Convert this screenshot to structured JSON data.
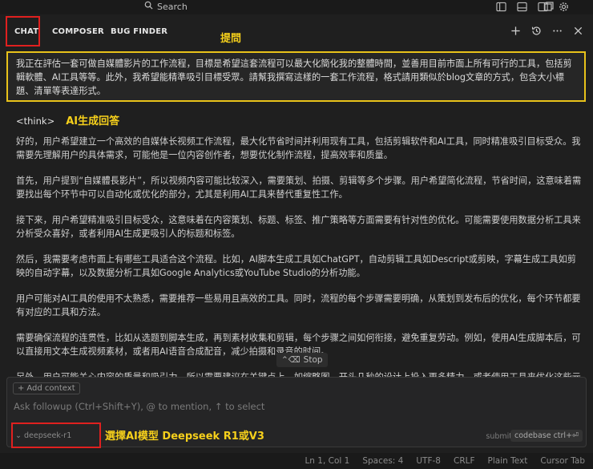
{
  "topbar": {
    "search_label": "Search"
  },
  "tabs": [
    {
      "label": "CHAT"
    },
    {
      "label": "COMPOSER"
    },
    {
      "label": "BUG FINDER"
    }
  ],
  "annotations": {
    "ask": "提問",
    "ai_answer": "AI生成回答",
    "model": "選擇AI模型 Deepseek R1或V3"
  },
  "question": "我正在評估一套可做自媒體影片的工作流程，目標是希望這套流程可以最大化簡化我的整體時間，並善用目前市面上所有可行的工具，包括剪輯軟體、AI工具等等。此外，我希望能精準吸引目標受眾。請幫我撰寫這樣的一套工作流程，格式請用類似於blog文章的方式，包含大小標題、清單等表達形式。",
  "answer": {
    "think_tag": "<think>",
    "paragraphs": [
      "好的，用户希望建立一个高效的自媒体长视频工作流程，最大化节省时间并利用现有工具，包括剪辑软件和AI工具，同时精准吸引目标受众。我需要先理解用户的具体需求，可能他是一位内容创作者，想要优化制作流程，提高效率和质量。",
      "首先，用户提到“自媒體長影片”，所以视频内容可能比较深入，需要策划、拍摄、剪辑等多个步骤。用户希望简化流程，节省时间，这意味着需要找出每个环节中可以自动化或优化的部分，尤其是利用AI工具来替代重复性工作。",
      "接下来，用户希望精准吸引目标受众，这意味着在内容策划、标题、标签、推广策略等方面需要有针对性的优化。可能需要使用数据分析工具来分析受众喜好，或者利用AI生成更吸引人的标题和标签。",
      "然后，我需要考虑市面上有哪些工具适合这个流程。比如，AI脚本生成工具如ChatGPT，自动剪辑工具如Descript或剪映，字幕生成工具如剪映的自动字幕，以及数据分析工具如Google Analytics或YouTube Studio的分析功能。",
      "用户可能对AI工具的使用不太熟悉，需要推荐一些易用且高效的工具。同时，流程的每个步骤需要明确，从策划到发布后的优化，每个环节都要有对应的工具和方法。",
      "需要确保流程的连贯性，比如从选题到脚本生成，再到素材收集和剪辑，每个步骤之间如何衔接，避免重复劳动。例如，使用AI生成脚本后，可以直接用文本生成视频素材，或者用AI语音合成配音，减少拍摄和录音的时间。",
      "另外，用户可能关心内容的质量和吸引力，所以需要建议在关键点上，如缩略图、开头几秒的设计上投入更多精力，或者使用工具来优化这些元素。"
    ],
    "stop_label": "Stop"
  },
  "composer": {
    "add_context_label": "Add context",
    "placeholder": "Ask followup (Ctrl+Shift+Y), @ to mention, ↑ to select",
    "model": "deepseek-r1",
    "submit_label": "submit",
    "codebase_label": "codebase ctrl+⏎"
  },
  "statusbar": {
    "position": "Ln 1, Col 1",
    "spaces": "Spaces: 4",
    "encoding": "UTF-8",
    "eol": "CRLF",
    "language": "Plain Text",
    "tab_mode": "Cursor Tab"
  }
}
